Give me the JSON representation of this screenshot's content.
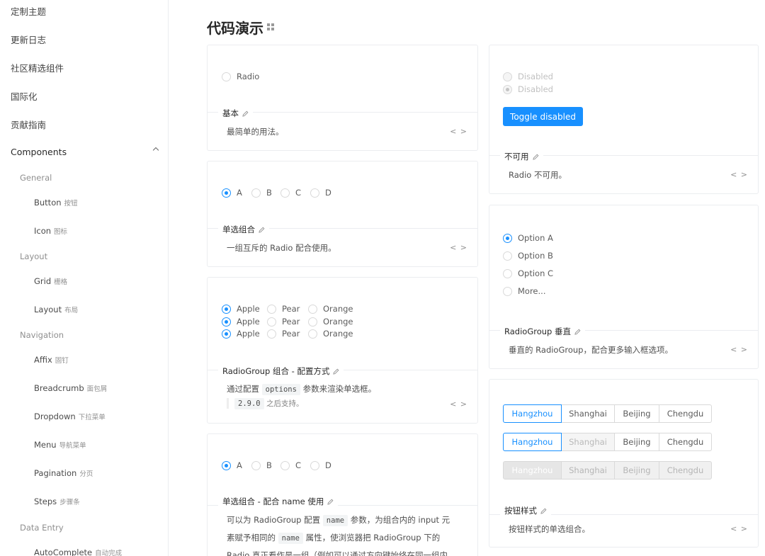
{
  "sidebar": {
    "top_items": [
      "定制主题",
      "更新日志",
      "社区精选组件",
      "国际化",
      "贡献指南"
    ],
    "components_label": "Components",
    "groups": [
      {
        "label": "General",
        "items": [
          {
            "en": "Button",
            "zh": "按钮"
          },
          {
            "en": "Icon",
            "zh": "图标"
          }
        ]
      },
      {
        "label": "Layout",
        "items": [
          {
            "en": "Grid",
            "zh": "栅格"
          },
          {
            "en": "Layout",
            "zh": "布局"
          }
        ]
      },
      {
        "label": "Navigation",
        "items": [
          {
            "en": "Affix",
            "zh": "固钉"
          },
          {
            "en": "Breadcrumb",
            "zh": "面包屑"
          },
          {
            "en": "Dropdown",
            "zh": "下拉菜单"
          },
          {
            "en": "Menu",
            "zh": "导航菜单"
          },
          {
            "en": "Pagination",
            "zh": "分页"
          },
          {
            "en": "Steps",
            "zh": "步骤条"
          }
        ]
      },
      {
        "label": "Data Entry",
        "items": [
          {
            "en": "AutoComplete",
            "zh": "自动完成"
          }
        ]
      }
    ]
  },
  "page_title": "代码演示",
  "code_toggle": "< >",
  "cards": {
    "basic": {
      "radio": "Radio",
      "title": "基本",
      "desc": "最简单的用法。"
    },
    "group": {
      "options": [
        "A",
        "B",
        "C",
        "D"
      ],
      "title": "单选组合",
      "desc": "一组互斥的 Radio 配合使用。"
    },
    "options_cfg": {
      "rows": [
        [
          "Apple",
          "Pear",
          "Orange"
        ],
        [
          "Apple",
          "Pear",
          "Orange"
        ],
        [
          "Apple",
          "Pear",
          "Orange"
        ]
      ],
      "title": "RadioGroup 组合 - 配置方式",
      "desc_a": "通过配置",
      "desc_code": "options",
      "desc_b": "参数来渲染单选框。",
      "note_code": "2.9.0",
      "note_text": "之后支持。"
    },
    "name_group": {
      "options": [
        "A",
        "B",
        "C",
        "D"
      ],
      "title": "单选组合 - 配合 name 使用",
      "l1a": "可以为 RadioGroup 配置",
      "l1code": "name",
      "l1b": "参数，为组合内的 input 元",
      "l2a": "素赋予相同的",
      "l2code": "name",
      "l2b": "属性，使浏览器把 RadioGroup 下的",
      "l3": "Radio 真正看作是一组（例如可以通过方向键始终在同一组内"
    },
    "disabled": {
      "r1": "Disabled",
      "r2": "Disabled",
      "button": "Toggle disabled",
      "title": "不可用",
      "desc": "Radio 不可用。"
    },
    "vertical": {
      "options": [
        "Option A",
        "Option B",
        "Option C",
        "More..."
      ],
      "title": "RadioGroup 垂直",
      "desc": "垂直的 RadioGroup，配合更多输入框选项。"
    },
    "button_style": {
      "cities": [
        "Hangzhou",
        "Shanghai",
        "Beijing",
        "Chengdu"
      ],
      "title": "按钮样式",
      "desc": "按钮样式的单选组合。"
    }
  },
  "colors": {
    "primary": "#1890ff",
    "border": "#ebedf0"
  }
}
